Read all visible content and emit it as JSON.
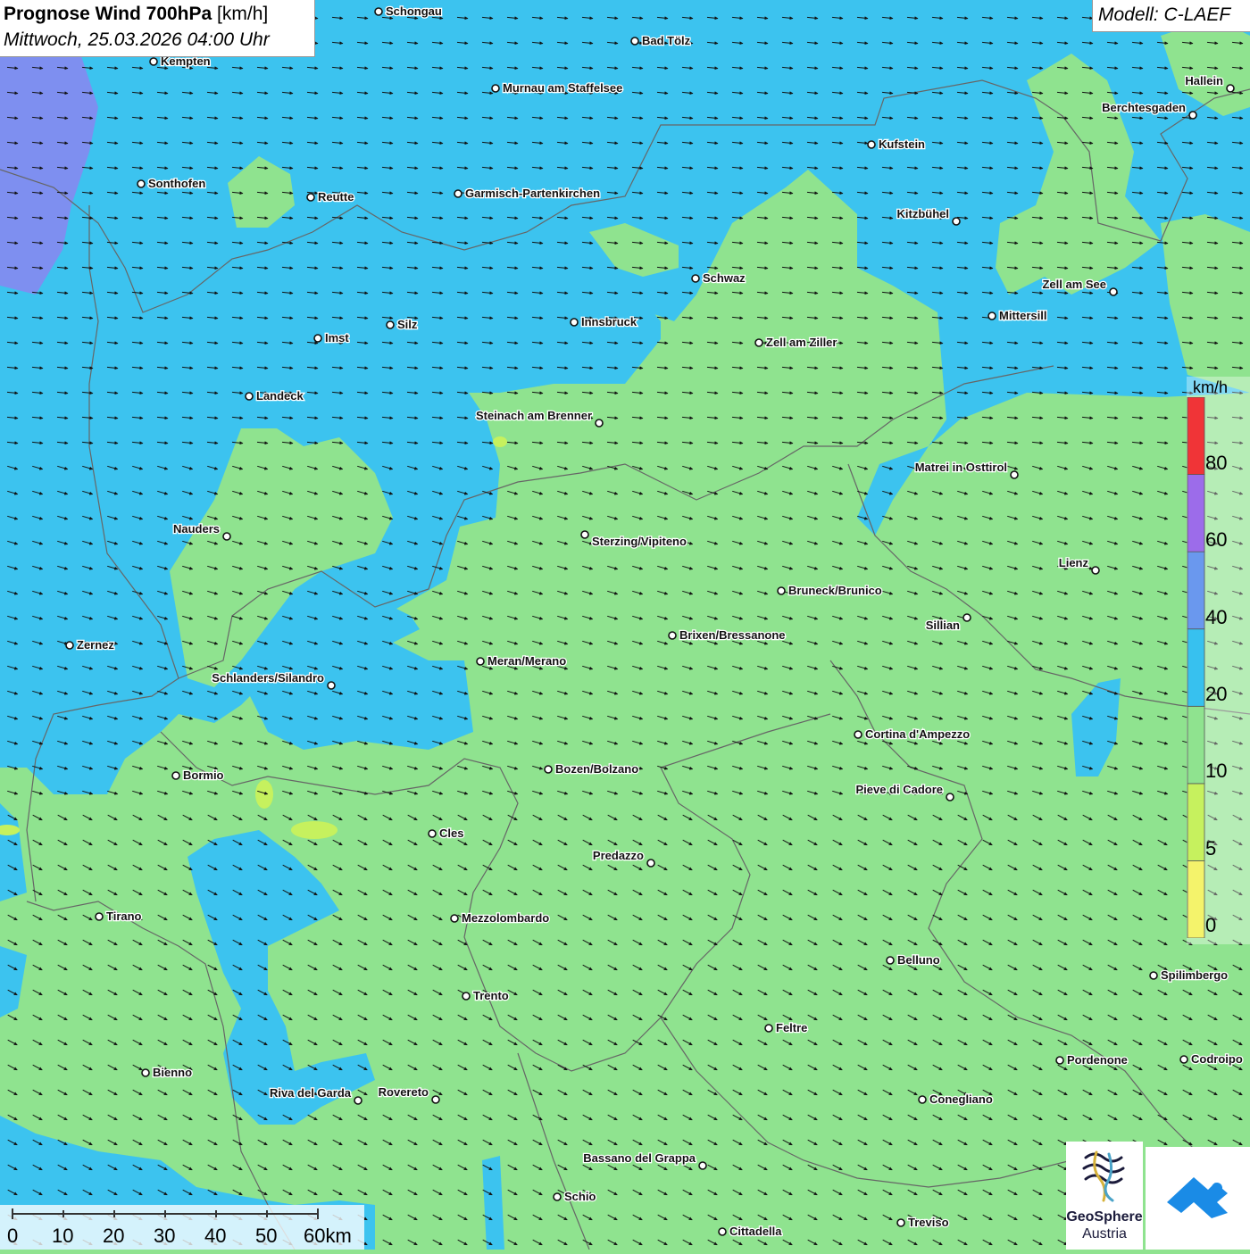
{
  "header": {
    "title_bold": "Prognose Wind 700hPa",
    "title_unit": "[km/h]",
    "datetime": "Mittwoch, 25.03.2026 04:00 Uhr"
  },
  "model": {
    "label": "Modell: C-LAEF"
  },
  "legend": {
    "unit": "km/h",
    "ticks": [
      "0",
      "5",
      "10",
      "20",
      "40",
      "60",
      "80"
    ],
    "colors": [
      "#f4f36b",
      "#c6f15e",
      "#8fe38f",
      "#37c1ef",
      "#6a98ee",
      "#9c6cea",
      "#f03437"
    ]
  },
  "scale_bar": {
    "labels": [
      "0",
      "10",
      "20",
      "30",
      "40",
      "50",
      "60km"
    ]
  },
  "logos": {
    "geosphere_line1": "GeoSphere",
    "geosphere_line2": "Austria"
  },
  "map_colors": {
    "green": "#8fe38f",
    "blue": "#3cc3ef",
    "purple": "#7e8ff0",
    "arrow": "#111111"
  },
  "cities": [
    {
      "name": "Schongau"
    },
    {
      "name": "Bad Tölz"
    },
    {
      "name": "Kempten"
    },
    {
      "name": "Murnau am Staffelsee"
    },
    {
      "name": "Hallein"
    },
    {
      "name": "Berchtesgaden"
    },
    {
      "name": "Kufstein"
    },
    {
      "name": "Sonthofen"
    },
    {
      "name": "Reutte"
    },
    {
      "name": "Garmisch-Partenkirchen"
    },
    {
      "name": "Kitzbühel"
    },
    {
      "name": "Schwaz"
    },
    {
      "name": "Zell am See"
    },
    {
      "name": "Innsbruck"
    },
    {
      "name": "Mittersill"
    },
    {
      "name": "Silz"
    },
    {
      "name": "Imst"
    },
    {
      "name": "Zell am Ziller"
    },
    {
      "name": "Landeck"
    },
    {
      "name": "Steinach am Brenner"
    },
    {
      "name": "Matrei in Osttirol"
    },
    {
      "name": "Nauders"
    },
    {
      "name": "Sterzing/Vipiteno"
    },
    {
      "name": "Lienz"
    },
    {
      "name": "Bruneck/Brunico"
    },
    {
      "name": "Sillian"
    },
    {
      "name": "Zernez"
    },
    {
      "name": "Brixen/Bressanone"
    },
    {
      "name": "Meran/Merano"
    },
    {
      "name": "Schlanders/Silandro"
    },
    {
      "name": "Cortina d'Ampezzo"
    },
    {
      "name": "Bozen/Bolzano"
    },
    {
      "name": "Bormio"
    },
    {
      "name": "Pieve di Cadore"
    },
    {
      "name": "Cles"
    },
    {
      "name": "Predazzo"
    },
    {
      "name": "Tirano"
    },
    {
      "name": "Mezzolombardo"
    },
    {
      "name": "Belluno"
    },
    {
      "name": "Spilimbergo"
    },
    {
      "name": "Trento"
    },
    {
      "name": "Feltre"
    },
    {
      "name": "Pordenone"
    },
    {
      "name": "Codroipo"
    },
    {
      "name": "Bienno"
    },
    {
      "name": "Riva del Garda"
    },
    {
      "name": "Rovereto"
    },
    {
      "name": "Conegliano"
    },
    {
      "name": "Bassano del Grappa"
    },
    {
      "name": "Schio"
    },
    {
      "name": "Treviso"
    },
    {
      "name": "Cittadella"
    }
  ]
}
